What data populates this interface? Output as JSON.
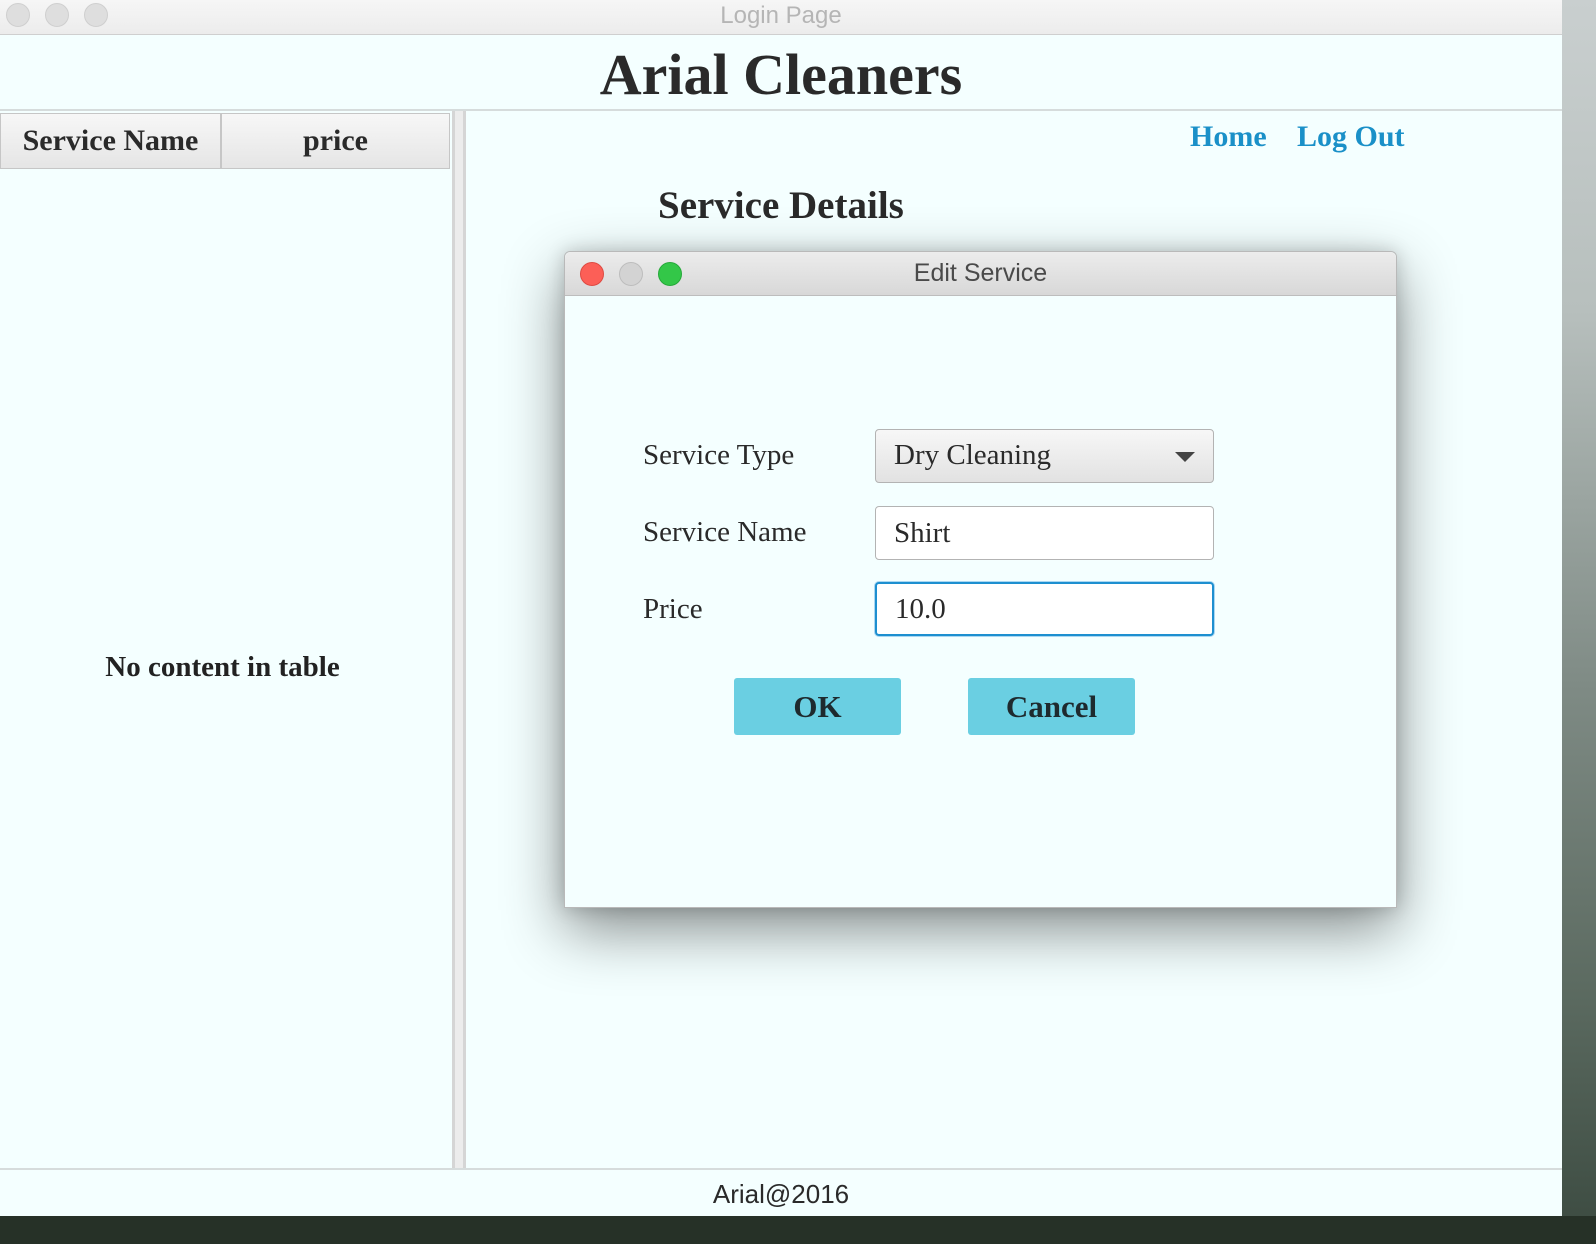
{
  "window": {
    "title": "Login Page"
  },
  "header": {
    "app_title": "Arial Cleaners"
  },
  "table": {
    "columns": [
      "Service Name",
      "price"
    ],
    "empty_message": "No content in table"
  },
  "nav": {
    "home": "Home",
    "logout": "Log Out"
  },
  "section": {
    "title": "Service Details"
  },
  "dialog": {
    "title": "Edit Service",
    "service_type_label": "Service Type",
    "service_type_value": "Dry Cleaning",
    "service_name_label": "Service Name",
    "service_name_value": "Shirt",
    "price_label": "Price",
    "price_value": "10.0",
    "ok_label": "OK",
    "cancel_label": "Cancel"
  },
  "footer": {
    "text": "Arial@2016"
  },
  "colors": {
    "background": "#f4ffff",
    "link": "#1a90c8",
    "button": "#6acfe2",
    "focus_ring": "#1d8fd0",
    "close": "#fc5f57",
    "minimize": "#cfcfcf",
    "zoom": "#33c748"
  }
}
